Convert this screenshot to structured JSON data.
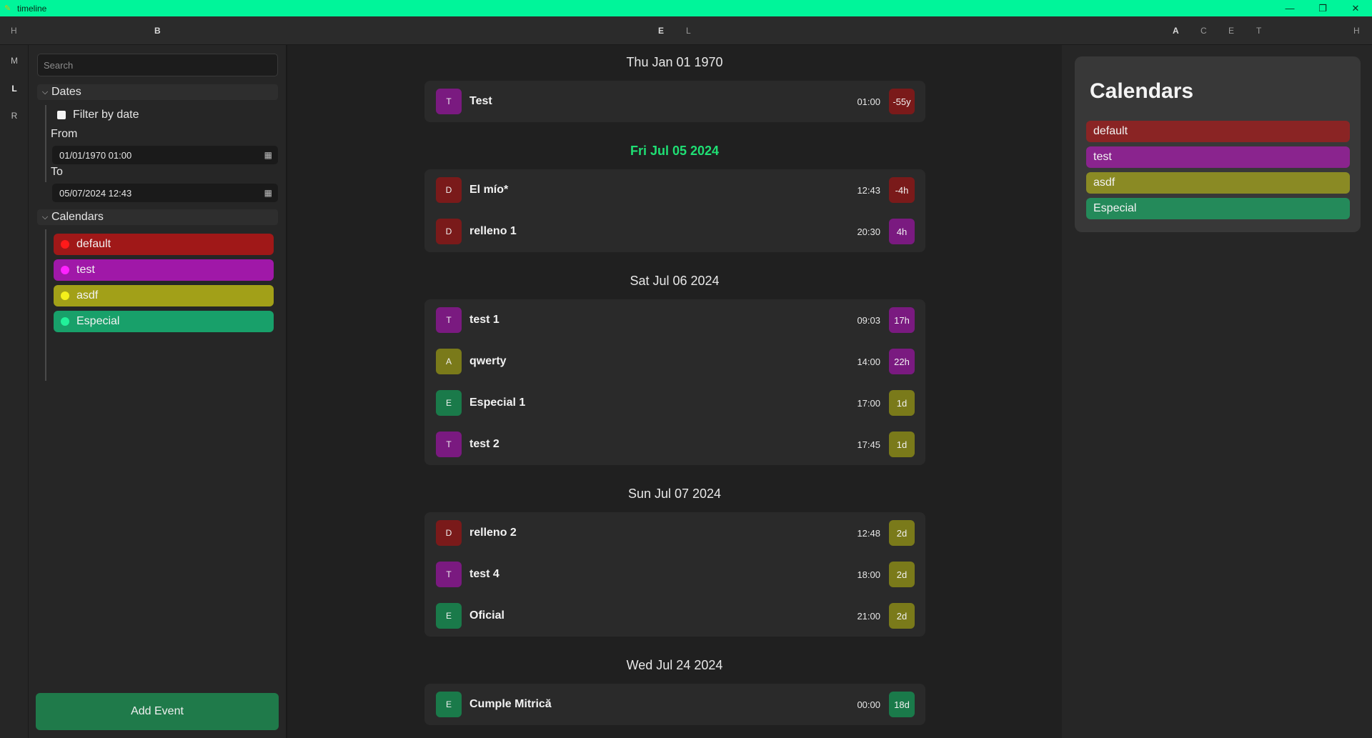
{
  "window": {
    "title": "timeline",
    "controls": [
      "—",
      "❐",
      "✕"
    ]
  },
  "toolbar": {
    "items": [
      "H",
      "B",
      "E",
      "L",
      "A",
      "C",
      "E",
      "T",
      "H"
    ]
  },
  "rail": {
    "items": [
      "M",
      "L",
      "R"
    ]
  },
  "sidebar": {
    "search_placeholder": "Search",
    "dates_label": "Dates",
    "filter_label": "Filter by date",
    "from_label": "From",
    "from_value": "01/01/1970 01:00",
    "to_label": "To",
    "to_value": "05/07/2024 12:43",
    "calendars_label": "Calendars",
    "calendars": [
      {
        "name": "default",
        "color": "#a01818",
        "dot": "#ff1a1a"
      },
      {
        "name": "test",
        "color": "#a018a8",
        "dot": "#ff22ff"
      },
      {
        "name": "asdf",
        "color": "#a2a018",
        "dot": "#f4f01a"
      },
      {
        "name": "Especial",
        "color": "#18a06a",
        "dot": "#22f09a"
      }
    ],
    "add_event_label": "Add Event"
  },
  "timeline": {
    "days": [
      {
        "date": "Thu Jan 01 1970",
        "today": false,
        "events": [
          {
            "initial": "T",
            "title": "Test",
            "time": "01:00",
            "badge": "-55y",
            "color": "#7a1a80",
            "badge_color": "#7a1a1a"
          }
        ]
      },
      {
        "date": "Fri Jul 05 2024",
        "today": true,
        "events": [
          {
            "initial": "D",
            "title": "El mío*",
            "time": "12:43",
            "badge": "-4h",
            "color": "#7a1a1a",
            "badge_color": "#7a1a1a"
          },
          {
            "initial": "D",
            "title": "relleno 1",
            "time": "20:30",
            "badge": "4h",
            "color": "#7a1a1a",
            "badge_color": "#7a1a80"
          }
        ]
      },
      {
        "date": "Sat Jul 06 2024",
        "today": false,
        "events": [
          {
            "initial": "T",
            "title": "test 1",
            "time": "09:03",
            "badge": "17h",
            "color": "#7a1a80",
            "badge_color": "#7a1a80"
          },
          {
            "initial": "A",
            "title": "qwerty",
            "time": "14:00",
            "badge": "22h",
            "color": "#7a7a1a",
            "badge_color": "#7a1a80"
          },
          {
            "initial": "E",
            "title": "Especial 1",
            "time": "17:00",
            "badge": "1d",
            "color": "#1a7a4a",
            "badge_color": "#7a7a1a"
          },
          {
            "initial": "T",
            "title": "test 2",
            "time": "17:45",
            "badge": "1d",
            "color": "#7a1a80",
            "badge_color": "#7a7a1a"
          }
        ]
      },
      {
        "date": "Sun Jul 07 2024",
        "today": false,
        "events": [
          {
            "initial": "D",
            "title": "relleno 2",
            "time": "12:48",
            "badge": "2d",
            "color": "#7a1a1a",
            "badge_color": "#7a7a1a"
          },
          {
            "initial": "T",
            "title": "test 4",
            "time": "18:00",
            "badge": "2d",
            "color": "#7a1a80",
            "badge_color": "#7a7a1a"
          },
          {
            "initial": "E",
            "title": "Oficial",
            "time": "21:00",
            "badge": "2d",
            "color": "#1a7a4a",
            "badge_color": "#7a7a1a"
          }
        ]
      },
      {
        "date": "Wed Jul 24 2024",
        "today": false,
        "events": [
          {
            "initial": "E",
            "title": "Cumple Mitrică",
            "time": "00:00",
            "badge": "18d",
            "color": "#1a7a4a",
            "badge_color": "#1a7a4a"
          }
        ]
      }
    ]
  },
  "right_panel": {
    "title": "Calendars",
    "calendars": [
      {
        "name": "default",
        "color": "#8a2424"
      },
      {
        "name": "test",
        "color": "#8a248e"
      },
      {
        "name": "asdf",
        "color": "#8a8a24"
      },
      {
        "name": "Especial",
        "color": "#248a5a"
      }
    ]
  }
}
